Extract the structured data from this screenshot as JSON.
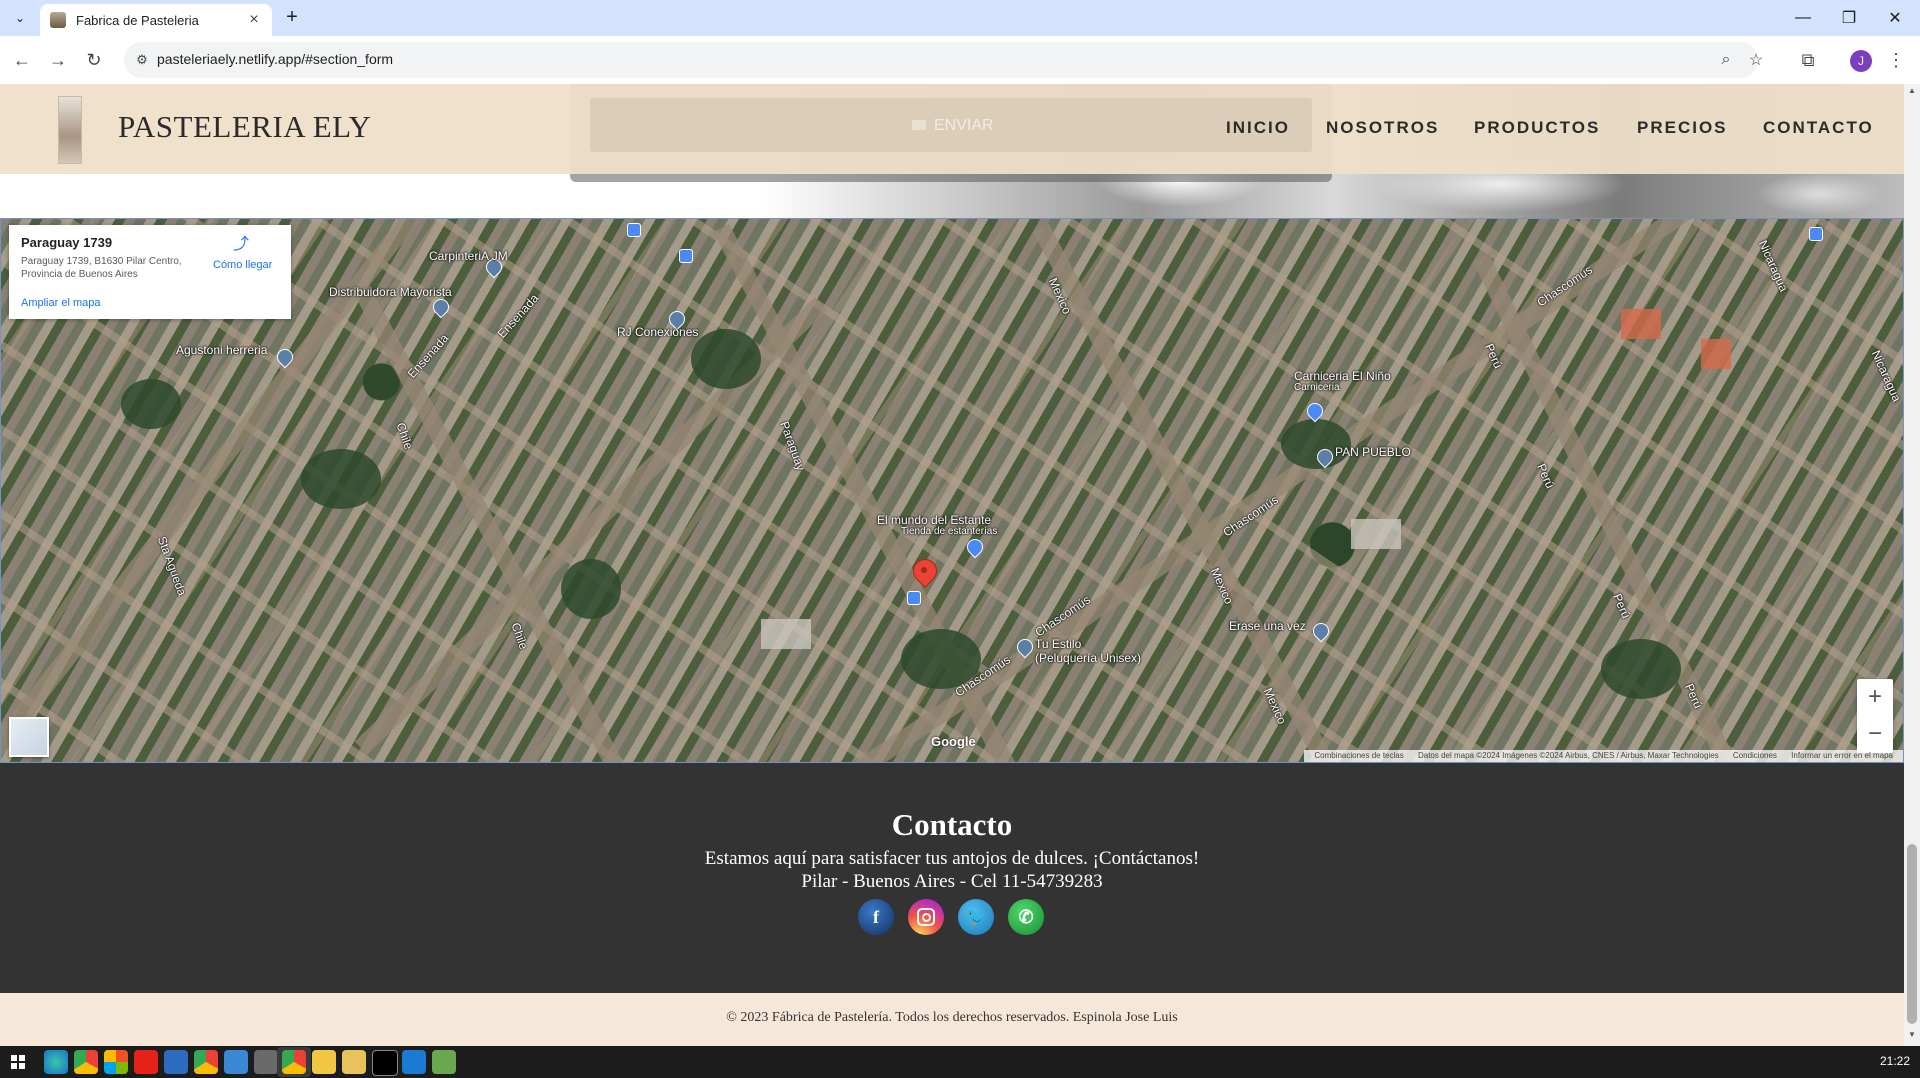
{
  "browser": {
    "tab_title": "Fabrica de Pasteleria",
    "url": "pasteleriaely.netlify.app/#section_form",
    "profile_initial": "J"
  },
  "header": {
    "brand": "PASTELERIA ELY",
    "send_label": "ENVIAR",
    "nav": [
      "INICIO",
      "NOSOTROS",
      "PRODUCTOS",
      "PRECIOS",
      "CONTACTO"
    ]
  },
  "map": {
    "info_title": "Paraguay 1739",
    "info_address": "Paraguay 1739, B1630 Pilar Centro, Provincia de Buenos Aires",
    "directions": "Cómo llegar",
    "enlarge": "Ampliar el mapa",
    "streets": [
      "Ensenada",
      "Ensenada",
      "Chile",
      "Chile",
      "Paraguay",
      "Mexico",
      "Mexico",
      "Mexico",
      "Chascomús",
      "Chascomús",
      "Chascomús",
      "Chascomús",
      "Perú",
      "Perú",
      "Perú",
      "Perú",
      "Nicaragua",
      "Nicaragua",
      "Sta Agueda"
    ],
    "places": [
      "CarpinteriA JM",
      "Distribuidora Mayorista",
      "RJ Conexiones",
      "Agustoni herreria",
      "Carniceria El Niño",
      "Carniceria",
      "PAN PUEBLO",
      "El mundo del Estante",
      "Tienda de estanterías",
      "Erase una vez",
      "Tu Estilo",
      "(Peluquería Unisex)"
    ],
    "google": "Google",
    "attribution": [
      "Combinaciones de teclas",
      "Datos del mapa ©2024 Imágenes ©2024 Airbus, CNES / Airbus, Maxar Technologies",
      "Condiciones",
      "Informar un error en el mapa"
    ],
    "zoom_in": "+",
    "zoom_out": "−"
  },
  "contact": {
    "title": "Contacto",
    "line1": "Estamos aquí para satisfacer tus antojos de dulces. ¡Contáctanos!",
    "line2": "Pilar - Buenos Aires - Cel 11-54739283",
    "socials": [
      "facebook",
      "instagram",
      "twitter",
      "whatsapp"
    ]
  },
  "footer": {
    "text": "© 2023 Fábrica de Pastelería. Todos los derechos reservados. Espinola Jose Luis"
  },
  "taskbar": {
    "clock": "21:22"
  }
}
